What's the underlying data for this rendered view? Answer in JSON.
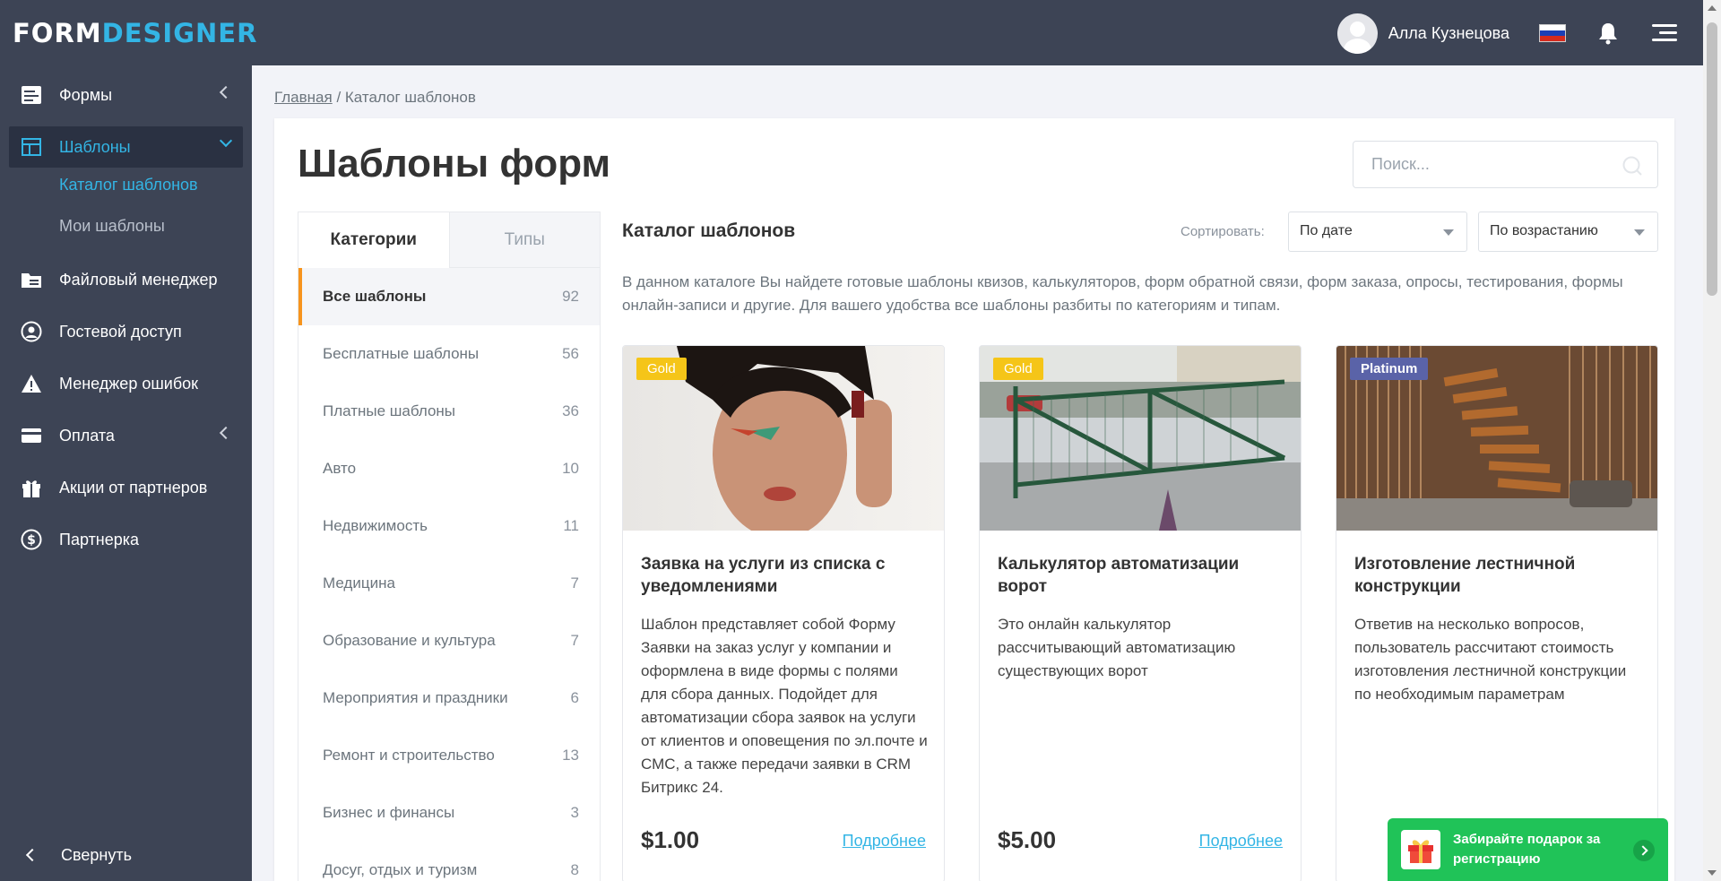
{
  "header": {
    "logo_part1": "FORM",
    "logo_part2": "DESIGNER",
    "user_name": "Алла Кузнецова",
    "language_flag": "flag-ru",
    "colors": {
      "bar": "#3d4455",
      "accent": "#33b5e5"
    }
  },
  "sidebar": {
    "items": [
      {
        "label": "Формы",
        "icon": "forms-icon"
      },
      {
        "label": "Шаблоны",
        "icon": "templates-icon"
      },
      {
        "label": "Файловый менеджер",
        "icon": "file-manager-icon"
      },
      {
        "label": "Гостевой доступ",
        "icon": "guest-icon"
      },
      {
        "label": "Менеджер ошибок",
        "icon": "warning-icon"
      },
      {
        "label": "Оплата",
        "icon": "card-icon"
      },
      {
        "label": "Акции от партнеров",
        "icon": "gift-icon"
      },
      {
        "label": "Партнерка",
        "icon": "dollar-icon"
      }
    ],
    "sub_items": [
      {
        "label": "Каталог шаблонов"
      },
      {
        "label": "Мои шаблоны"
      }
    ],
    "collapse_label": "Свернуть"
  },
  "breadcrumb": {
    "home": "Главная",
    "separator": " / ",
    "current": "Каталог шаблонов"
  },
  "page": {
    "title": "Шаблоны форм",
    "search_placeholder": "Поиск..."
  },
  "categories": {
    "tabs": [
      "Категории",
      "Типы"
    ],
    "items": [
      {
        "label": "Все шаблоны",
        "count": "92"
      },
      {
        "label": "Бесплатные шаблоны",
        "count": "56"
      },
      {
        "label": "Платные шаблоны",
        "count": "36"
      },
      {
        "label": "Авто",
        "count": "10"
      },
      {
        "label": "Недвижимость",
        "count": "11"
      },
      {
        "label": "Медицина",
        "count": "7"
      },
      {
        "label": "Образование и культура",
        "count": "7"
      },
      {
        "label": "Мероприятия и праздники",
        "count": "6"
      },
      {
        "label": "Ремонт и строительство",
        "count": "13"
      },
      {
        "label": "Бизнес и финансы",
        "count": "3"
      },
      {
        "label": "Досуг, отдых и туризм",
        "count": "8"
      }
    ]
  },
  "catalog": {
    "title": "Каталог шаблонов",
    "sort_label": "Сортировать:",
    "sort_by": "По дате",
    "sort_order": "По возрастанию",
    "intro": "В данном каталоге Вы найдете готовые шаблоны квизов, калькуляторов, форм обратной связи, форм заказа, опросы, тестирования, формы онлайн-записи и другие. Для вашего удобства все шаблоны разбиты по категориям и типам.",
    "cards": [
      {
        "badge": "Gold",
        "title": "Заявка на услуги из списка с уведомлениями",
        "description": "Шаблон представляет собой Форму Заявки на заказ услуг у компании и оформлена в виде формы с полями для сбора данных. Подойдет для автоматизации сбора заявок на услуги от клиентов и оповещения по эл.почте и СМС, а также передачи заявки в CRM Битрикс 24.",
        "price": "$1.00",
        "more": "Подробнее"
      },
      {
        "badge": "Gold",
        "title": "Калькулятор автоматизации ворот",
        "description": "Это онлайн калькулятор рассчитывающий автоматизацию существующих ворот",
        "price": "$5.00",
        "more": "Подробнее"
      },
      {
        "badge": "Platinum",
        "title": "Изготовление лестничной конструкции",
        "description": "Ответив на несколько вопросов, пользователь рассчитают стоимость изготовления лестничной конструкции по необходимым параметрам"
      }
    ]
  },
  "gift_banner": {
    "text": "Забирайте подарок за регистрацию"
  }
}
